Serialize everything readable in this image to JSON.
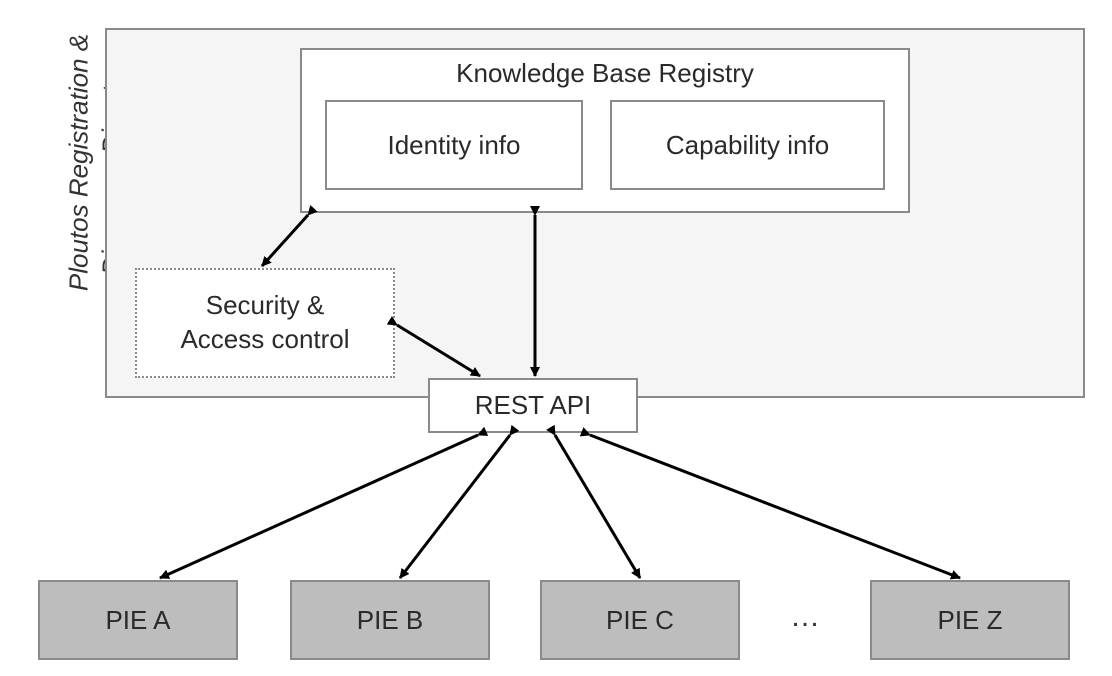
{
  "title_rotated": "Ploutos Registration & Discovery Directory",
  "kbr": {
    "label": "Knowledge Base Registry"
  },
  "identity": {
    "label": "Identity info"
  },
  "capability": {
    "label": "Capability info"
  },
  "security": {
    "line1": "Security  &",
    "line2": "Access control"
  },
  "rest": {
    "label": "REST API"
  },
  "pies": {
    "a": "PIE A",
    "b": "PIE B",
    "c": "PIE C",
    "z": "PIE Z"
  },
  "ellipsis": "…",
  "colors": {
    "outer_fill": "#f5f5f5",
    "box_border": "#8a8a8a",
    "pie_fill": "#bdbdbd",
    "arrow": "#000000"
  }
}
